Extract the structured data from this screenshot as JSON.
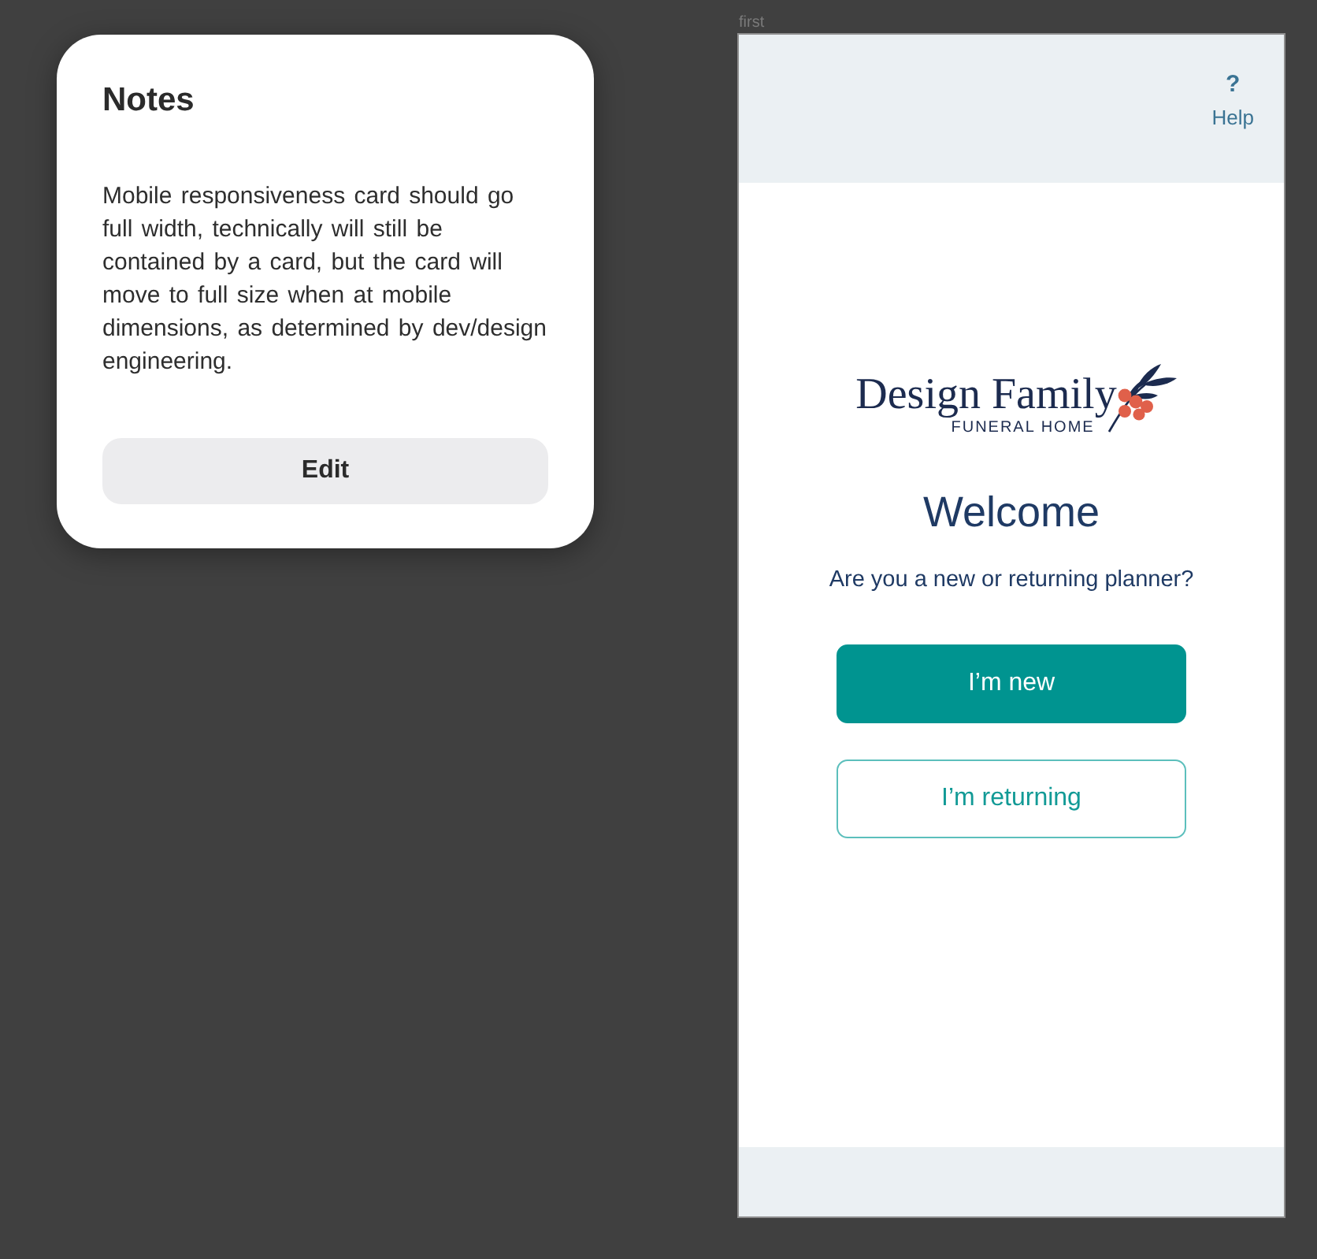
{
  "notes_card": {
    "title": "Notes",
    "body": "Mobile responsiveness card should go full width, technically will still be contained by a card, but the card will move to full size when at mobile dimensions, as determined by dev/design engineering.",
    "button": "Edit"
  },
  "frame": {
    "label": "first",
    "header": {
      "help_icon": "?",
      "help_label": "Help"
    },
    "logo": {
      "name": "Design Family",
      "tagline": "FUNERAL HOME"
    },
    "title": "Welcome",
    "prompt": "Are you a new or returning planner?",
    "buttons": [
      {
        "label": "I’m new",
        "kind": "primary"
      },
      {
        "label": "I’m returning",
        "kind": "outline"
      }
    ]
  }
}
